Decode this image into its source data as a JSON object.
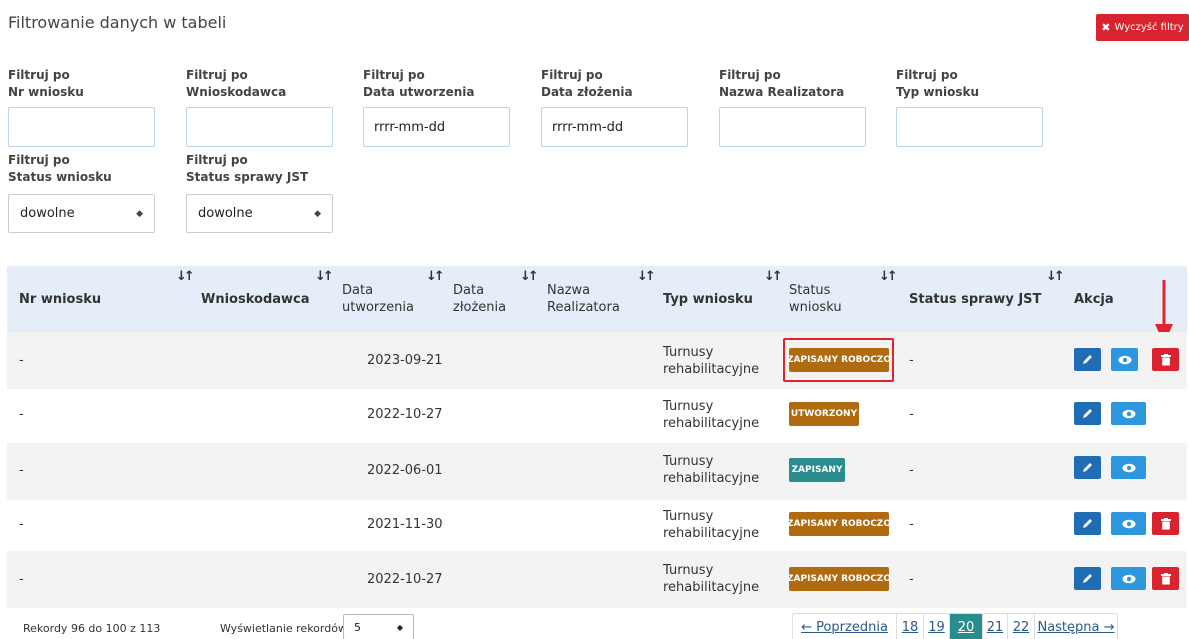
{
  "title": "Filtrowanie danych w tabeli",
  "clear_button": "Wyczyść filtry",
  "filters": [
    {
      "line1": "Filtruj po",
      "line2": "Nr wniosku",
      "value": ""
    },
    {
      "line1": "Filtruj po",
      "line2": "Wnioskodawca",
      "value": ""
    },
    {
      "line1": "Filtruj po",
      "line2": "Data utworzenia",
      "value": "rrrr-mm-dd"
    },
    {
      "line1": "Filtruj po",
      "line2": "Data złożenia",
      "value": "rrrr-mm-dd"
    },
    {
      "line1": "Filtruj po",
      "line2": "Nazwa Realizatora",
      "value": ""
    },
    {
      "line1": "Filtruj po",
      "line2": "Typ wniosku",
      "value": ""
    }
  ],
  "select_filters": [
    {
      "line1": "Filtruj po",
      "line2": "Status wniosku",
      "value": "dowolne"
    },
    {
      "line1": "Filtruj po",
      "line2": "Status sprawy JST",
      "value": "dowolne"
    }
  ],
  "columns": [
    {
      "line1": "Nr wniosku",
      "line2": ""
    },
    {
      "line1": "Wnioskodawca",
      "line2": ""
    },
    {
      "line1": "Data",
      "line2": "utworzenia"
    },
    {
      "line1": "Data",
      "line2": "złożenia"
    },
    {
      "line1": "Nazwa",
      "line2": "Realizatora"
    },
    {
      "line1": "Typ wniosku",
      "line2": ""
    },
    {
      "line1": "Status",
      "line2": "wniosku"
    },
    {
      "line1": "Status sprawy JST",
      "line2": ""
    },
    {
      "line1": "Akcja",
      "line2": ""
    }
  ],
  "sort_icon": "sort-arrows-icon",
  "rows": [
    {
      "nr": "-",
      "date": "2023-09-21",
      "typ1": "Turnusy",
      "typ2": "rehabilitacyjne",
      "status": "ZAPISANY ROBOCZO",
      "jst": "-",
      "deletable": true,
      "highlighted": true
    },
    {
      "nr": "-",
      "date": "2022-10-27",
      "typ1": "Turnusy",
      "typ2": "rehabilitacyjne",
      "status": "UTWORZONY",
      "jst": "-",
      "deletable": false,
      "highlighted": false
    },
    {
      "nr": "-",
      "date": "2022-06-01",
      "typ1": "Turnusy",
      "typ2": "rehabilitacyjne",
      "status": "ZAPISANY",
      "jst": "-",
      "deletable": false,
      "highlighted": false
    },
    {
      "nr": "-",
      "date": "2021-11-30",
      "typ1": "Turnusy",
      "typ2": "rehabilitacyjne",
      "status": "ZAPISANY ROBOCZO",
      "jst": "-",
      "deletable": true,
      "highlighted": false
    },
    {
      "nr": "-",
      "date": "2022-10-27",
      "typ1": "Turnusy",
      "typ2": "rehabilitacyjne",
      "status": "ZAPISANY ROBOCZO",
      "jst": "-",
      "deletable": true,
      "highlighted": false
    }
  ],
  "footer": {
    "records": "Rekordy 96 do 100 z 113",
    "per_page_label": "Wyświetlanie rekordów",
    "per_page": "5"
  },
  "pagination": {
    "prev": "← Poprzednia",
    "pages": [
      "18",
      "19",
      "20",
      "21",
      "22"
    ],
    "active": "20",
    "next": "Następna →"
  },
  "colors": {
    "accent": "#2a8d8d",
    "danger": "#d9232e",
    "draft": "#b06a10",
    "header_bg": "#e5eef8"
  }
}
